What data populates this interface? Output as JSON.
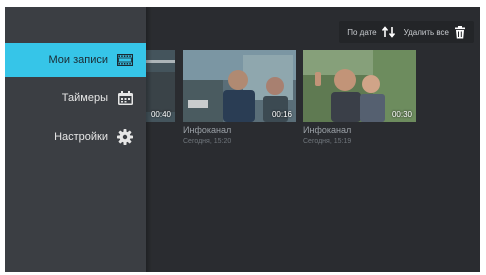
{
  "sidebar": {
    "items": [
      {
        "label": "Мои записи",
        "icon": "film-icon",
        "active": true
      },
      {
        "label": "Таймеры",
        "icon": "calendar-icon",
        "active": false
      },
      {
        "label": "Настройки",
        "icon": "gear-icon",
        "active": false
      }
    ]
  },
  "toolbar": {
    "sort_label": "По дате",
    "sort_icon": "sort-arrows-icon",
    "delete_all_label": "Удалить все",
    "delete_icon": "trash-icon"
  },
  "recordings": [
    {
      "duration": "00:40",
      "title": "",
      "date": ""
    },
    {
      "duration": "00:16",
      "title": "Инфоканал",
      "date": "Сегодня, 15:20"
    },
    {
      "duration": "00:30",
      "title": "Инфоканал",
      "date": "Сегодня, 15:19"
    }
  ],
  "colors": {
    "accent": "#36c5e8",
    "sidebar_bg": "#3b3e43",
    "content_bg": "#2a2c30"
  }
}
